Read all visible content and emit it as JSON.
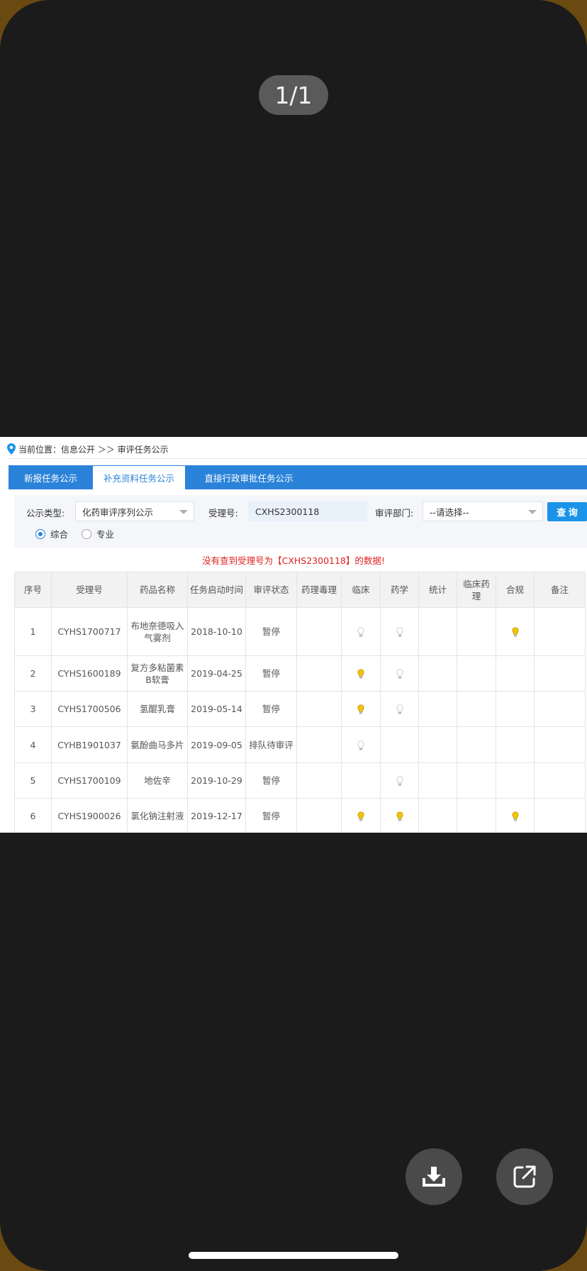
{
  "viewer": {
    "page_counter": "1/1"
  },
  "page": {
    "breadcrumb": "当前位置：信息公开 ＞＞ 审评任务公示",
    "tabs": [
      {
        "label": "新报任务公示",
        "active": false
      },
      {
        "label": "补充资料任务公示",
        "active": true
      },
      {
        "label": "直接行政审批任务公示",
        "active": false
      }
    ],
    "filters": {
      "type_label": "公示类型:",
      "type_value": "化药审评序列公示",
      "receipt_label": "受理号:",
      "receipt_value": "CXHS2300118",
      "dept_label": "审评部门:",
      "dept_value": "--请选择--",
      "query_label": "查 询",
      "radio_general": "综合",
      "radio_specialty": "专业"
    },
    "message": "没有查到受理号为【CXHS2300118】的数据!",
    "table": {
      "headers": [
        "序号",
        "受理号",
        "药品名称",
        "任务启动时间",
        "审评状态",
        "药理毒理",
        "临床",
        "药学",
        "统计",
        "临床药理",
        "合规",
        "备注"
      ],
      "rows": [
        {
          "no": "1",
          "id": "CYHS1700717",
          "name": "布地奈德吸入气雾剂",
          "start": "2018-10-10",
          "status": "暂停",
          "pharm_tox": "",
          "clinical": "grey",
          "pharmacy": "grey",
          "stats": "",
          "clin_pharm": "",
          "compliance": "yellow",
          "remark": ""
        },
        {
          "no": "2",
          "id": "CYHS1600189",
          "name": "复方多粘菌素B软膏",
          "start": "2019-04-25",
          "status": "暂停",
          "pharm_tox": "",
          "clinical": "yellow",
          "pharmacy": "grey",
          "stats": "",
          "clin_pharm": "",
          "compliance": "",
          "remark": ""
        },
        {
          "no": "3",
          "id": "CYHS1700506",
          "name": "氢醌乳膏",
          "start": "2019-05-14",
          "status": "暂停",
          "pharm_tox": "",
          "clinical": "yellow",
          "pharmacy": "grey",
          "stats": "",
          "clin_pharm": "",
          "compliance": "",
          "remark": ""
        },
        {
          "no": "4",
          "id": "CYHB1901037",
          "name": "氨酚曲马多片",
          "start": "2019-09-05",
          "status": "排队待审评",
          "pharm_tox": "",
          "clinical": "grey",
          "pharmacy": "",
          "stats": "",
          "clin_pharm": "",
          "compliance": "",
          "remark": ""
        },
        {
          "no": "5",
          "id": "CYHS1700109",
          "name": "地佐辛",
          "start": "2019-10-29",
          "status": "暂停",
          "pharm_tox": "",
          "clinical": "",
          "pharmacy": "grey",
          "stats": "",
          "clin_pharm": "",
          "compliance": "",
          "remark": ""
        },
        {
          "no": "6",
          "id": "CYHS1900026",
          "name": "氯化钠注射液",
          "start": "2019-12-17",
          "status": "暂停",
          "pharm_tox": "",
          "clinical": "yellow",
          "pharmacy": "yellow",
          "stats": "",
          "clin_pharm": "",
          "compliance": "yellow",
          "remark": ""
        }
      ]
    }
  },
  "icons": {
    "location": "location-pin-icon",
    "download": "download-icon",
    "share": "share-external-icon",
    "bulb": "lightbulb-icon"
  },
  "colors": {
    "tab_bar": "#2b83d9",
    "query_button": "#1b93e8",
    "error_text": "#e02020",
    "bulb_on": "#f1c40f",
    "bulb_off": "#c8c8c8"
  }
}
